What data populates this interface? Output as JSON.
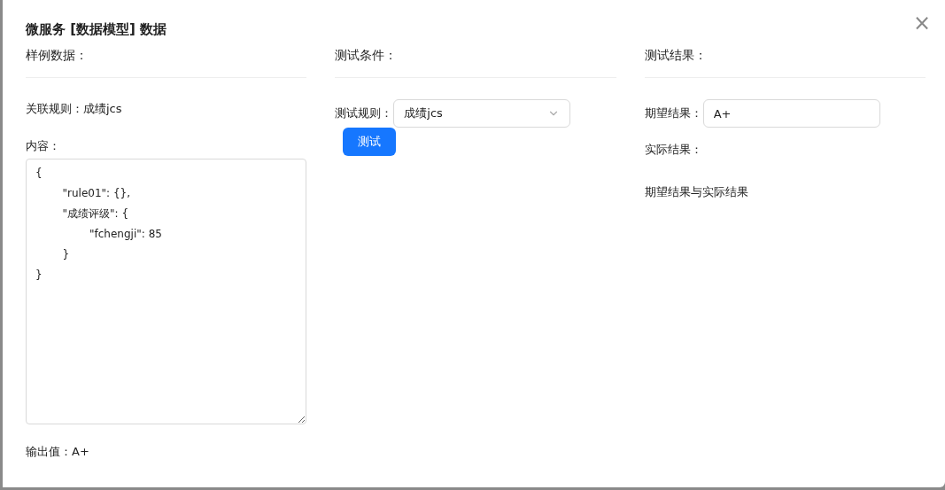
{
  "dialog": {
    "title": "微服务 [数据模型] 数据",
    "close": "×"
  },
  "sample": {
    "heading": "样例数据：",
    "rule_label": "关联规则：",
    "rule_value": "成绩jcs",
    "content_label": "内容：",
    "content": "{\n\t\"rule01\": {},\n\t\"成绩评级\": {\n\t\t\"fchengji\": 85\n\t}\n}",
    "output_label": "输出值：",
    "output_value": "A+"
  },
  "conditions": {
    "heading": "测试条件：",
    "rule_label": "测试规则：",
    "rule_value": "成绩jcs",
    "button": "测试"
  },
  "results": {
    "heading": "测试结果：",
    "expected_label": "期望结果：",
    "expected_value": "A+",
    "actual_label": "实际结果：",
    "compare_text": "期望结果与实际结果"
  }
}
